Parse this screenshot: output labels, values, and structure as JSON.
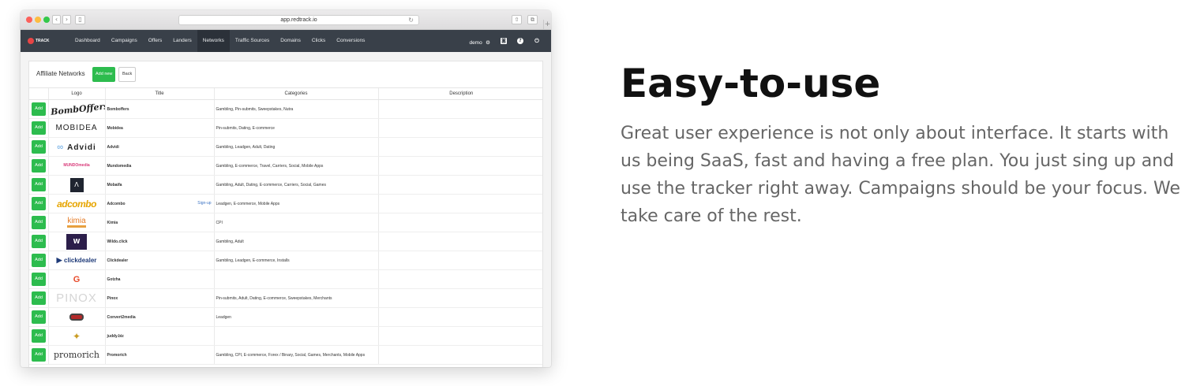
{
  "browser": {
    "url": "app.redtrack.io",
    "nav_back": "‹",
    "nav_forward": "›",
    "sidebar_icon": "▯",
    "reload_icon": "↻",
    "share_icon": "⇧",
    "tabs_icon": "⧉",
    "new_tab_icon": "+"
  },
  "app_nav": {
    "logo_text": "TRACK",
    "items": [
      "Dashboard",
      "Campaigns",
      "Offers",
      "Landers",
      "Networks",
      "Traffic Sources",
      "Domains",
      "Clicks",
      "Conversions"
    ],
    "active_index": 4,
    "user_label": "demo",
    "settings_icon": "⚙",
    "rss_icon": "◙",
    "help_icon": "?",
    "power_icon": "⏻"
  },
  "content": {
    "title": "Affiliate Networks",
    "add_new_label": "Add new",
    "back_label": "Back",
    "columns": [
      "Logo",
      "Title",
      "Categories",
      "Description"
    ],
    "add_label": "Add",
    "rows": [
      {
        "logo": "BombOffers",
        "logo_style": "script",
        "title": "Bomboffers",
        "categories": "Gambling, Pin-submits, Sweepstakes, Nutra",
        "signup": ""
      },
      {
        "logo": "MOBIDEA",
        "logo_style": "caps",
        "title": "Mobidea",
        "categories": "Pin-submits, Dating, E-commerce",
        "signup": ""
      },
      {
        "logo": "Advidi",
        "logo_style": "advidi",
        "title": "Advidi",
        "categories": "Gambling, Leadgen, Adult, Dating",
        "signup": ""
      },
      {
        "logo": "MUNDOmedia",
        "logo_style": "mundo",
        "title": "Mundomedia",
        "categories": "Gambling, E-commerce, Travel, Carriers, Social, Mobile Apps",
        "signup": ""
      },
      {
        "logo": "Λ",
        "logo_style": "dark",
        "title": "Mobaifa",
        "categories": "Gambling, Adult, Dating, E-commerce, Carriers, Social, Games",
        "signup": ""
      },
      {
        "logo": "adcombo",
        "logo_style": "adcombo",
        "title": "Adcombo",
        "categories": "Leadgen, E-commerce, Mobile Apps",
        "signup": "Sign-up"
      },
      {
        "logo": "kimia",
        "logo_style": "kimia",
        "title": "Kimia",
        "categories": "CPI",
        "signup": ""
      },
      {
        "logo": "W",
        "logo_style": "purple",
        "title": "Wildo.click",
        "categories": "Gambling, Adult",
        "signup": ""
      },
      {
        "logo": "clickdealer",
        "logo_style": "click",
        "title": "Clickdealer",
        "categories": "Gambling, Leadgen, E-commerce, Installs",
        "signup": ""
      },
      {
        "logo": "G",
        "logo_style": "gotzha",
        "title": "Gotzha",
        "categories": "",
        "signup": ""
      },
      {
        "logo": "PINOX",
        "logo_style": "pinox",
        "title": "Pinox",
        "categories": "Pin-submits, Adult, Dating, E-commerce, Sweepstakes, Merchants",
        "signup": ""
      },
      {
        "logo": "",
        "logo_style": "convert",
        "title": "Convert2media",
        "categories": "Leadgen",
        "signup": ""
      },
      {
        "logo": "✦",
        "logo_style": "juddy",
        "title": "juddy.biz",
        "categories": "",
        "signup": ""
      },
      {
        "logo": "promorich",
        "logo_style": "promo",
        "title": "Promorich",
        "categories": "Gambling, CPI, E-commerce, Forex / Binary, Social, Games, Merchants, Mobile Apps",
        "signup": ""
      }
    ]
  },
  "marketing": {
    "headline": "Easy-to-use",
    "paragraph": "Great user experience is not only about interface. It starts with us being SaaS, fast and having a free plan. You just sing up and use the tracker right away. Campaigns should be your focus. We take care of the rest."
  }
}
